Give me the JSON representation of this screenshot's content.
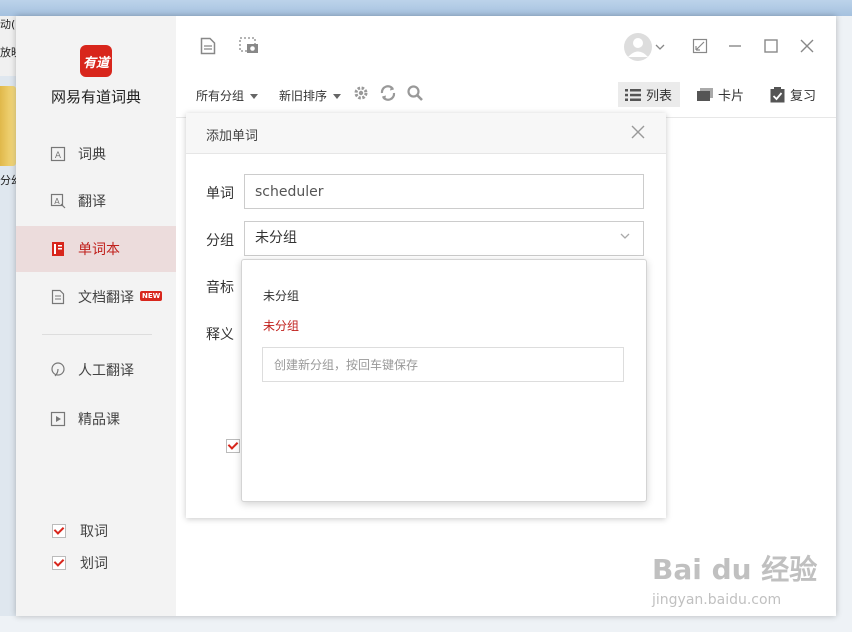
{
  "background": {
    "menu_fragment": "动(H",
    "menu_fragment2": "放映",
    "folder_label": "分幻"
  },
  "app": {
    "logo_text": "有道",
    "name": "网易有道词典",
    "brand_color": "#d8261c"
  },
  "sidebar": {
    "items": [
      {
        "label": "词典",
        "icon": "dictionary-icon"
      },
      {
        "label": "翻译",
        "icon": "translate-icon"
      },
      {
        "label": "单词本",
        "icon": "wordbook-icon",
        "active": true
      },
      {
        "label": "文档翻译",
        "icon": "document-icon",
        "badge": "NEW"
      },
      {
        "label": "人工翻译",
        "icon": "human-translate-icon"
      },
      {
        "label": "精品课",
        "icon": "course-icon"
      }
    ],
    "options": [
      {
        "label": "取词",
        "checked": true
      },
      {
        "label": "划词",
        "checked": true
      }
    ]
  },
  "toolbar": {
    "group_filter": "所有分组",
    "sort_filter": "新旧排序",
    "views": [
      {
        "label": "列表",
        "active": true
      },
      {
        "label": "卡片",
        "active": false
      },
      {
        "label": "复习",
        "active": false
      }
    ]
  },
  "dialog": {
    "title": "添加单词",
    "word_label": "单词",
    "word_value": "scheduler",
    "group_label": "分组",
    "group_value": "未分组",
    "phonetic_label": "音标",
    "meaning_label": "释义"
  },
  "dropdown": {
    "options": [
      "未分组",
      "未分组"
    ],
    "selected_index": 1,
    "new_group_placeholder": "创建新分组，按回车键保存"
  },
  "watermark": {
    "line1": "Bai du 经验",
    "line2": "jingyan.baidu.com"
  }
}
